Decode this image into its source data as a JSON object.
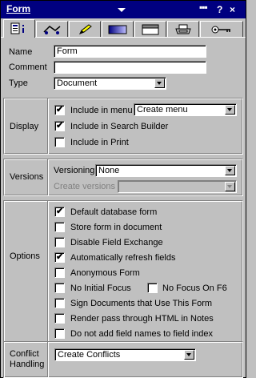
{
  "title": "Form",
  "titlebar": {
    "menu_dots": "▪▪▪",
    "help": "?",
    "close": "×"
  },
  "tabs": [
    {
      "name": "tab-info",
      "icon": "info-icon"
    },
    {
      "name": "tab-launch",
      "icon": "launch-icon"
    },
    {
      "name": "tab-design",
      "icon": "pencil-icon"
    },
    {
      "name": "tab-background",
      "icon": "background-icon"
    },
    {
      "name": "tab-header",
      "icon": "header-icon"
    },
    {
      "name": "tab-print",
      "icon": "printer-icon"
    },
    {
      "name": "tab-security",
      "icon": "key-icon"
    }
  ],
  "basics": {
    "name_label": "Name",
    "name_value": "Form",
    "comment_label": "Comment",
    "comment_value": "",
    "type_label": "Type",
    "type_value": "Document"
  },
  "display": {
    "label": "Display",
    "include_in_menu": {
      "label": "Include in menu",
      "checked": true
    },
    "menu_select": "Create menu",
    "include_in_search": {
      "label": "Include in Search Builder",
      "checked": true
    },
    "include_in_print": {
      "label": "Include in Print",
      "checked": false
    }
  },
  "versions": {
    "label": "Versions",
    "versioning_label": "Versioning",
    "versioning_value": "None",
    "create_versions_label": "Create versions",
    "create_versions_value": ""
  },
  "options": {
    "label": "Options",
    "default_form": {
      "label": "Default database form",
      "checked": true
    },
    "store_form": {
      "label": "Store form in document",
      "checked": false
    },
    "disable_field_exchange": {
      "label": "Disable Field Exchange",
      "checked": false
    },
    "auto_refresh": {
      "label": "Automatically refresh fields",
      "checked": true
    },
    "anonymous_form": {
      "label": "Anonymous Form",
      "checked": false
    },
    "no_initial_focus": {
      "label": "No Initial Focus",
      "checked": false
    },
    "no_focus_f6": {
      "label": "No Focus On F6",
      "checked": false
    },
    "sign_documents": {
      "label": "Sign Documents that Use This Form",
      "checked": false
    },
    "render_pass": {
      "label": "Render pass through HTML in Notes",
      "checked": false
    },
    "no_field_names": {
      "label": "Do not add field names to field index",
      "checked": false
    }
  },
  "conflict": {
    "label_line1": "Conflict",
    "label_line2": "Handling",
    "value": "Create Conflicts"
  },
  "check_glyph": "✔"
}
